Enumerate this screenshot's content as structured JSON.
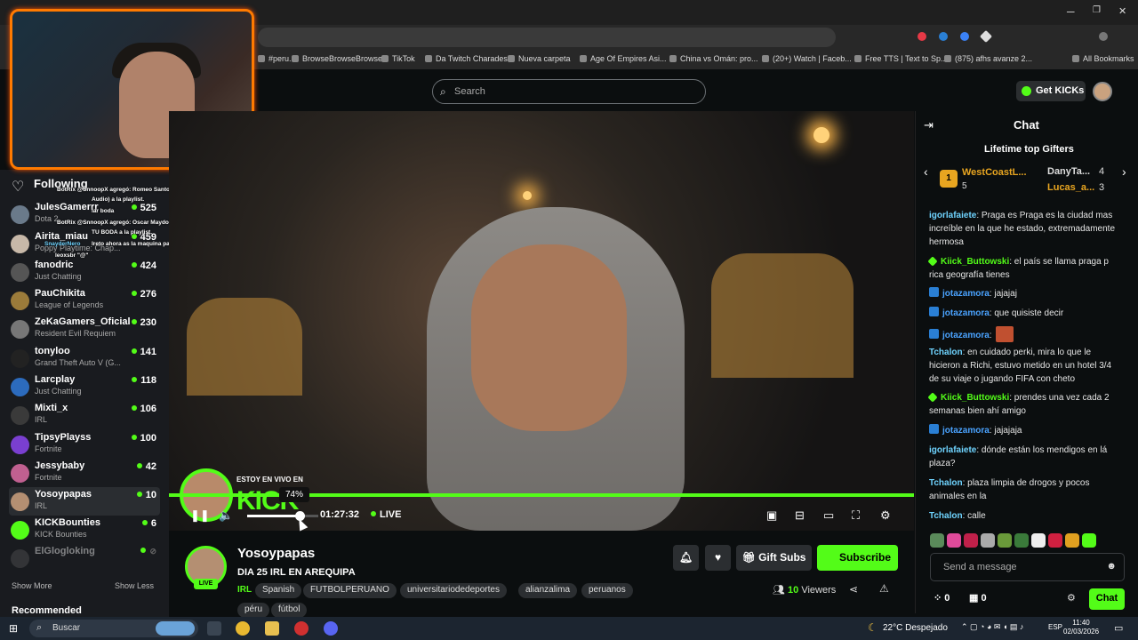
{
  "browser": {
    "bookmarks": [
      "#peru...",
      "BrowseBrowseBrowse",
      "TikTok",
      "Da Twitch Charades",
      "Nueva carpeta",
      "Age Of Empires Asi...",
      "China vs Omán: pro...",
      "(20+) Watch | Faceb...",
      "Free TTS | Text to Sp...",
      "(875) afhs avanze 2...",
      "All Bookmarks"
    ],
    "win_min": "─",
    "win_max": "❐",
    "win_close": "✕"
  },
  "header": {
    "search_placeholder": "Search",
    "get_kicks": "Get KICKs"
  },
  "sidebar": {
    "following": "Following",
    "channels": [
      {
        "name": "JulesGamerrr",
        "category": "Dota 2",
        "viewers": "525",
        "color": "#6a7a8a"
      },
      {
        "name": "Airita_miau",
        "category": "Poppy Playtime: Chap...",
        "viewers": "459",
        "color": "#c7b8a8"
      },
      {
        "name": "fanodric",
        "category": "Just Chatting",
        "viewers": "424",
        "color": "#555"
      },
      {
        "name": "PauChikita",
        "category": "League of Legends",
        "viewers": "276",
        "color": "#9b7b3a"
      },
      {
        "name": "ZeKaGamers_Oficial",
        "category": "Resident Evil Requiem",
        "viewers": "230",
        "color": "#777"
      },
      {
        "name": "tonyloo",
        "category": "Grand Theft Auto V (G...",
        "viewers": "141",
        "color": "#222"
      },
      {
        "name": "Larcplay",
        "category": "Just Chatting",
        "viewers": "118",
        "color": "#2c6bbd"
      },
      {
        "name": "Mixti_x",
        "category": "IRL",
        "viewers": "106",
        "color": "#3a3a3a"
      },
      {
        "name": "TipsyPlayss",
        "category": "Fortnite",
        "viewers": "100",
        "color": "#7a3fd0"
      },
      {
        "name": "Jessybaby",
        "category": "Fortnite",
        "viewers": "42",
        "color": "#c06090"
      },
      {
        "name": "Yosoypapas",
        "category": "IRL",
        "viewers": "10",
        "color": "#b48f72"
      },
      {
        "name": "KICKBounties",
        "category": "KICK Bounties",
        "viewers": "6",
        "color": "#53fc18"
      },
      {
        "name": "ElGlogloking",
        "category": "",
        "viewers": "",
        "color": "#555"
      }
    ],
    "show_more": "Show More",
    "show_less": "Show Less",
    "recommended": "Recommended"
  },
  "overlay": {
    "lines": [
      "BotRix @SnnoopX agregó: Romeo Santos - Hilito (Official",
      "Audio) a la playlist.",
      "lar boda",
      "BotRix @SnnoopX agregó: Oscar Maydon x Fuerza Regida -",
      "TU BODA a la playlist.",
      "SnayderNero",
      "lreto ahora as la maquina para hacer vias",
      "leoxsbr \"@\""
    ]
  },
  "player": {
    "overlay_top": "ESTOY EN VIVO EN",
    "overlay_logo": "KICK",
    "volume_tooltip": "74%",
    "volume": 0.74,
    "time": "01:27:32",
    "live": "LIVE"
  },
  "stream": {
    "channel": "Yosoypapas",
    "title": "DIA 25 IRL EN AREQUIPA",
    "live_badge": "LIVE",
    "category": "IRL",
    "tags": [
      "Spanish",
      "FUTBOLPERUANO",
      "universitariodedeportes",
      "alianzalima",
      "peruanos",
      "péru",
      "fútbol"
    ],
    "gift_subs": "Gift Subs",
    "subscribe": "Subscribe",
    "viewers_count": "10",
    "viewers_label": "Viewers"
  },
  "chat": {
    "title": "Chat",
    "gifters_title": "Lifetime top Gifters",
    "gifters": [
      {
        "name": "WestCoastL...",
        "count": "5",
        "rank": "1"
      },
      {
        "name": "DanyTa...",
        "count": "4"
      },
      {
        "name": "Lucas_a...",
        "count": "3"
      }
    ],
    "messages": [
      {
        "user": "igorlafaiete",
        "color": "#6fd4ff",
        "text": ": Praga es Praga es la ciudad mas increíble en la que he estado, extremadamente hermosa",
        "badge": ""
      },
      {
        "user": "Kiick_Buttowski",
        "color": "#53fc18",
        "text": ": el país se llama praga p rica geografía tienes",
        "badge": "g"
      },
      {
        "user": "jotazamora",
        "color": "#4aa3ff",
        "text": ": jajajaj",
        "badge": "b"
      },
      {
        "user": "jotazamora",
        "color": "#4aa3ff",
        "text": ": que quisiste decir",
        "badge": "b"
      },
      {
        "user": "jotazamora",
        "color": "#4aa3ff",
        "text": ":",
        "badge": "b"
      },
      {
        "user": "Tchalon",
        "color": "#6fd4ff",
        "text": ": en cuidado perki, mira lo que le hicieron a Richi, estuvo metido en un hotel 3/4 de su viaje o jugando FIFA con cheto",
        "badge": ""
      },
      {
        "user": "Kiick_Buttowski",
        "color": "#53fc18",
        "text": ": prendes una vez cada 2 semanas bien ahí amigo",
        "badge": "g"
      },
      {
        "user": "jotazamora",
        "color": "#4aa3ff",
        "text": ": jajajaja",
        "badge": "b"
      },
      {
        "user": "igorlafaiete",
        "color": "#6fd4ff",
        "text": ": dónde están los mendigos en lá plaza?",
        "badge": ""
      },
      {
        "user": "Tchalon",
        "color": "#6fd4ff",
        "text": ": plaza limpia de drogos y pocos animales en la",
        "badge": ""
      },
      {
        "user": "Tchalon",
        "color": "#6fd4ff",
        "text": ": calle",
        "badge": ""
      }
    ],
    "send_placeholder": "Send a message",
    "kicks_balance": "0",
    "gifts_balance": "0",
    "chat_button": "Chat"
  },
  "taskbar": {
    "search": "Buscar",
    "weather": "22°C  Despejado",
    "lang": "ESP",
    "time": "11:40",
    "date": "02/03/2026"
  },
  "colors": {
    "accent": "#53fc18",
    "cam_border": "#ff7a00"
  }
}
